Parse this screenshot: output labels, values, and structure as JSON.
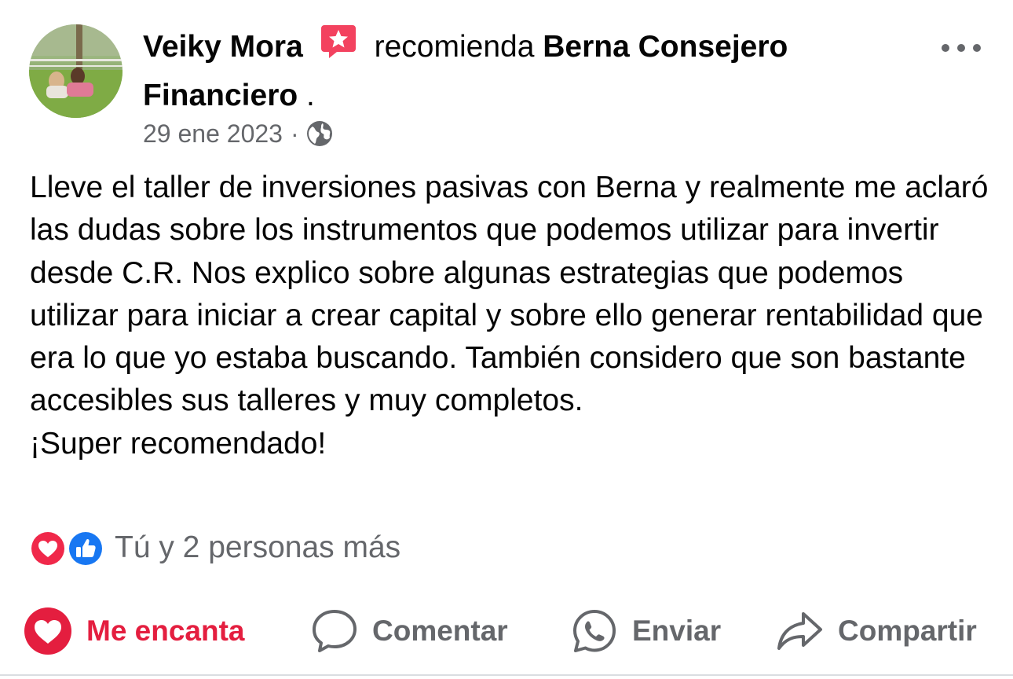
{
  "post": {
    "author": "Veiky Mora",
    "recommends_text": "recomienda",
    "page_name": "Berna Consejero Financiero",
    "page_name_suffix": " .",
    "date": "29 ene 2023",
    "separator": "·",
    "privacy_icon": "globe-icon",
    "body": "Lleve el taller de inversiones pasivas con Berna y realmente me aclaró las dudas sobre los instrumentos que podemos utilizar para invertir desde C.R. Nos explico sobre algunas estrategias que podemos utilizar para iniciar a crear capital y sobre ello generar rentabilidad que era lo que yo estaba buscando. También considero que son bastante accesibles sus talleres y muy completos.\n¡Super recomendado!"
  },
  "reactions": {
    "icons": [
      "love-reaction-icon",
      "like-reaction-icon"
    ],
    "summary": "Tú y 2 personas más"
  },
  "actions": {
    "love_label": "Me encanta",
    "comment_label": "Comentar",
    "send_label": "Enviar",
    "share_label": "Compartir"
  },
  "colors": {
    "love_red": "#e41e3f",
    "like_blue": "#1877f2",
    "secondary_text": "#65676b",
    "badge_pink": "#f3425f"
  }
}
